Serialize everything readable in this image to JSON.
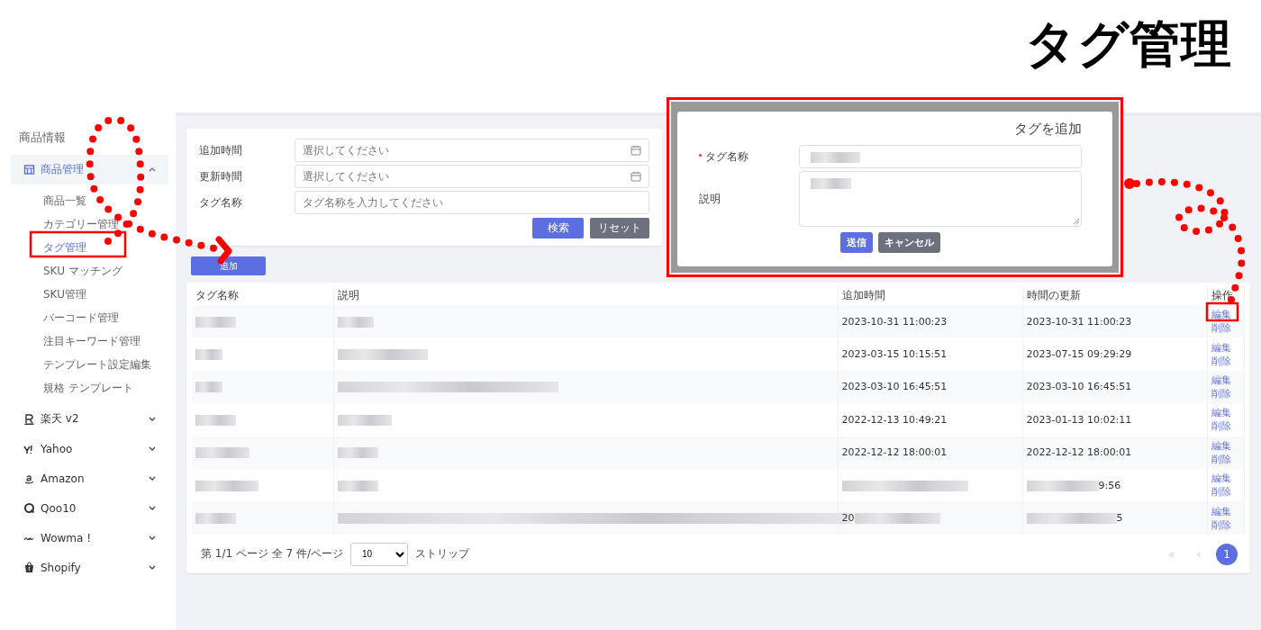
{
  "page_title": "タグ管理",
  "sidebar": {
    "section": "商品情報",
    "groups": [
      {
        "label": "商品管理",
        "expanded": true,
        "selected": true,
        "children": [
          {
            "label": "商品一覧",
            "selected": false
          },
          {
            "label": "カテゴリー管理",
            "selected": false
          },
          {
            "label": "タグ管理",
            "selected": true
          },
          {
            "label": "SKU マッチング",
            "selected": false
          },
          {
            "label": "SKU管理",
            "selected": false
          },
          {
            "label": "バーコード管理",
            "selected": false
          },
          {
            "label": "注目キーワード管理",
            "selected": false
          },
          {
            "label": "テンプレート設定編集",
            "selected": false
          },
          {
            "label": "規格 テンプレート",
            "selected": false
          }
        ]
      },
      {
        "label": "楽天 v2",
        "expanded": false,
        "selected": false
      },
      {
        "label": "Yahoo",
        "expanded": false,
        "selected": false
      },
      {
        "label": "Amazon",
        "expanded": false,
        "selected": false
      },
      {
        "label": "Qoo10",
        "expanded": false,
        "selected": false
      },
      {
        "label": "Wowma !",
        "expanded": false,
        "selected": false
      },
      {
        "label": "Shopify",
        "expanded": false,
        "selected": false
      }
    ]
  },
  "filters": [
    {
      "label": "追加時間",
      "placeholder": "選択してください",
      "kind": "date"
    },
    {
      "label": "更新時間",
      "placeholder": "選択してください",
      "kind": "date"
    },
    {
      "label": "タグ名称",
      "placeholder": "タグ名称を入力してください",
      "kind": "text"
    }
  ],
  "filter_buttons": [
    {
      "label": "検索",
      "kind": "primary"
    },
    {
      "label": "リセット",
      "kind": "secondary"
    }
  ],
  "add_button": "追加",
  "table": {
    "columns": [
      "タグ名称",
      "説明",
      "追加時間",
      "時間の更新",
      "操作"
    ],
    "rows": [
      {
        "cells": [
          {
            "masked": true
          },
          {
            "masked": true
          },
          {
            "text": "2023-10-31 11:00:23"
          },
          {
            "text": "2023-10-31 11:00:23"
          }
        ],
        "actions": [
          "編集",
          "削除"
        ]
      },
      {
        "cells": [
          {
            "masked": true
          },
          {
            "masked": true
          },
          {
            "text": "2023-03-15 10:15:51"
          },
          {
            "text": "2023-07-15 09:29:29"
          }
        ],
        "actions": [
          "編集",
          "削除"
        ]
      },
      {
        "cells": [
          {
            "masked": true
          },
          {
            "masked": true
          },
          {
            "text": "2023-03-10 16:45:51"
          },
          {
            "text": "2023-03-10 16:45:51"
          }
        ],
        "actions": [
          "編集",
          "削除"
        ]
      },
      {
        "cells": [
          {
            "masked": true
          },
          {
            "masked": true
          },
          {
            "text": "2022-12-13 10:49:21"
          },
          {
            "text": "2023-01-13 10:02:11"
          }
        ],
        "actions": [
          "編集",
          "削除"
        ]
      },
      {
        "cells": [
          {
            "masked": true
          },
          {
            "masked": true
          },
          {
            "text": "2022-12-12 18:00:01"
          },
          {
            "text": "2022-12-12 18:00:01"
          }
        ],
        "actions": [
          "編集",
          "削除"
        ]
      },
      {
        "cells": [
          {
            "masked": true
          },
          {
            "masked": true
          },
          {
            "masked": true
          },
          {
            "masked": true,
            "tail": "9:56"
          }
        ],
        "actions": [
          "編集",
          "削除"
        ]
      },
      {
        "cells": [
          {
            "masked": true
          },
          {
            "masked": true
          },
          {
            "text": "20",
            "masked": true
          },
          {
            "masked": true,
            "tail": "5"
          }
        ],
        "actions": [
          "編集",
          "削除"
        ]
      }
    ]
  },
  "pagination": {
    "info": "第 1/1 ページ 全 7 件/ページ",
    "page_size": "10",
    "suffix": "ストリップ",
    "first": "«",
    "prev": "‹",
    "pages": [
      {
        "label": "1",
        "selected": true
      }
    ]
  },
  "dialog": {
    "title": "タグを追加",
    "fields": [
      {
        "label": "タグ名称",
        "required": true,
        "kind": "input",
        "masked": true
      },
      {
        "label": "説明",
        "required": false,
        "kind": "textarea",
        "masked": true
      }
    ],
    "buttons": [
      {
        "label": "送信",
        "kind": "primary"
      },
      {
        "label": "キャンセル",
        "kind": "secondary"
      }
    ]
  }
}
